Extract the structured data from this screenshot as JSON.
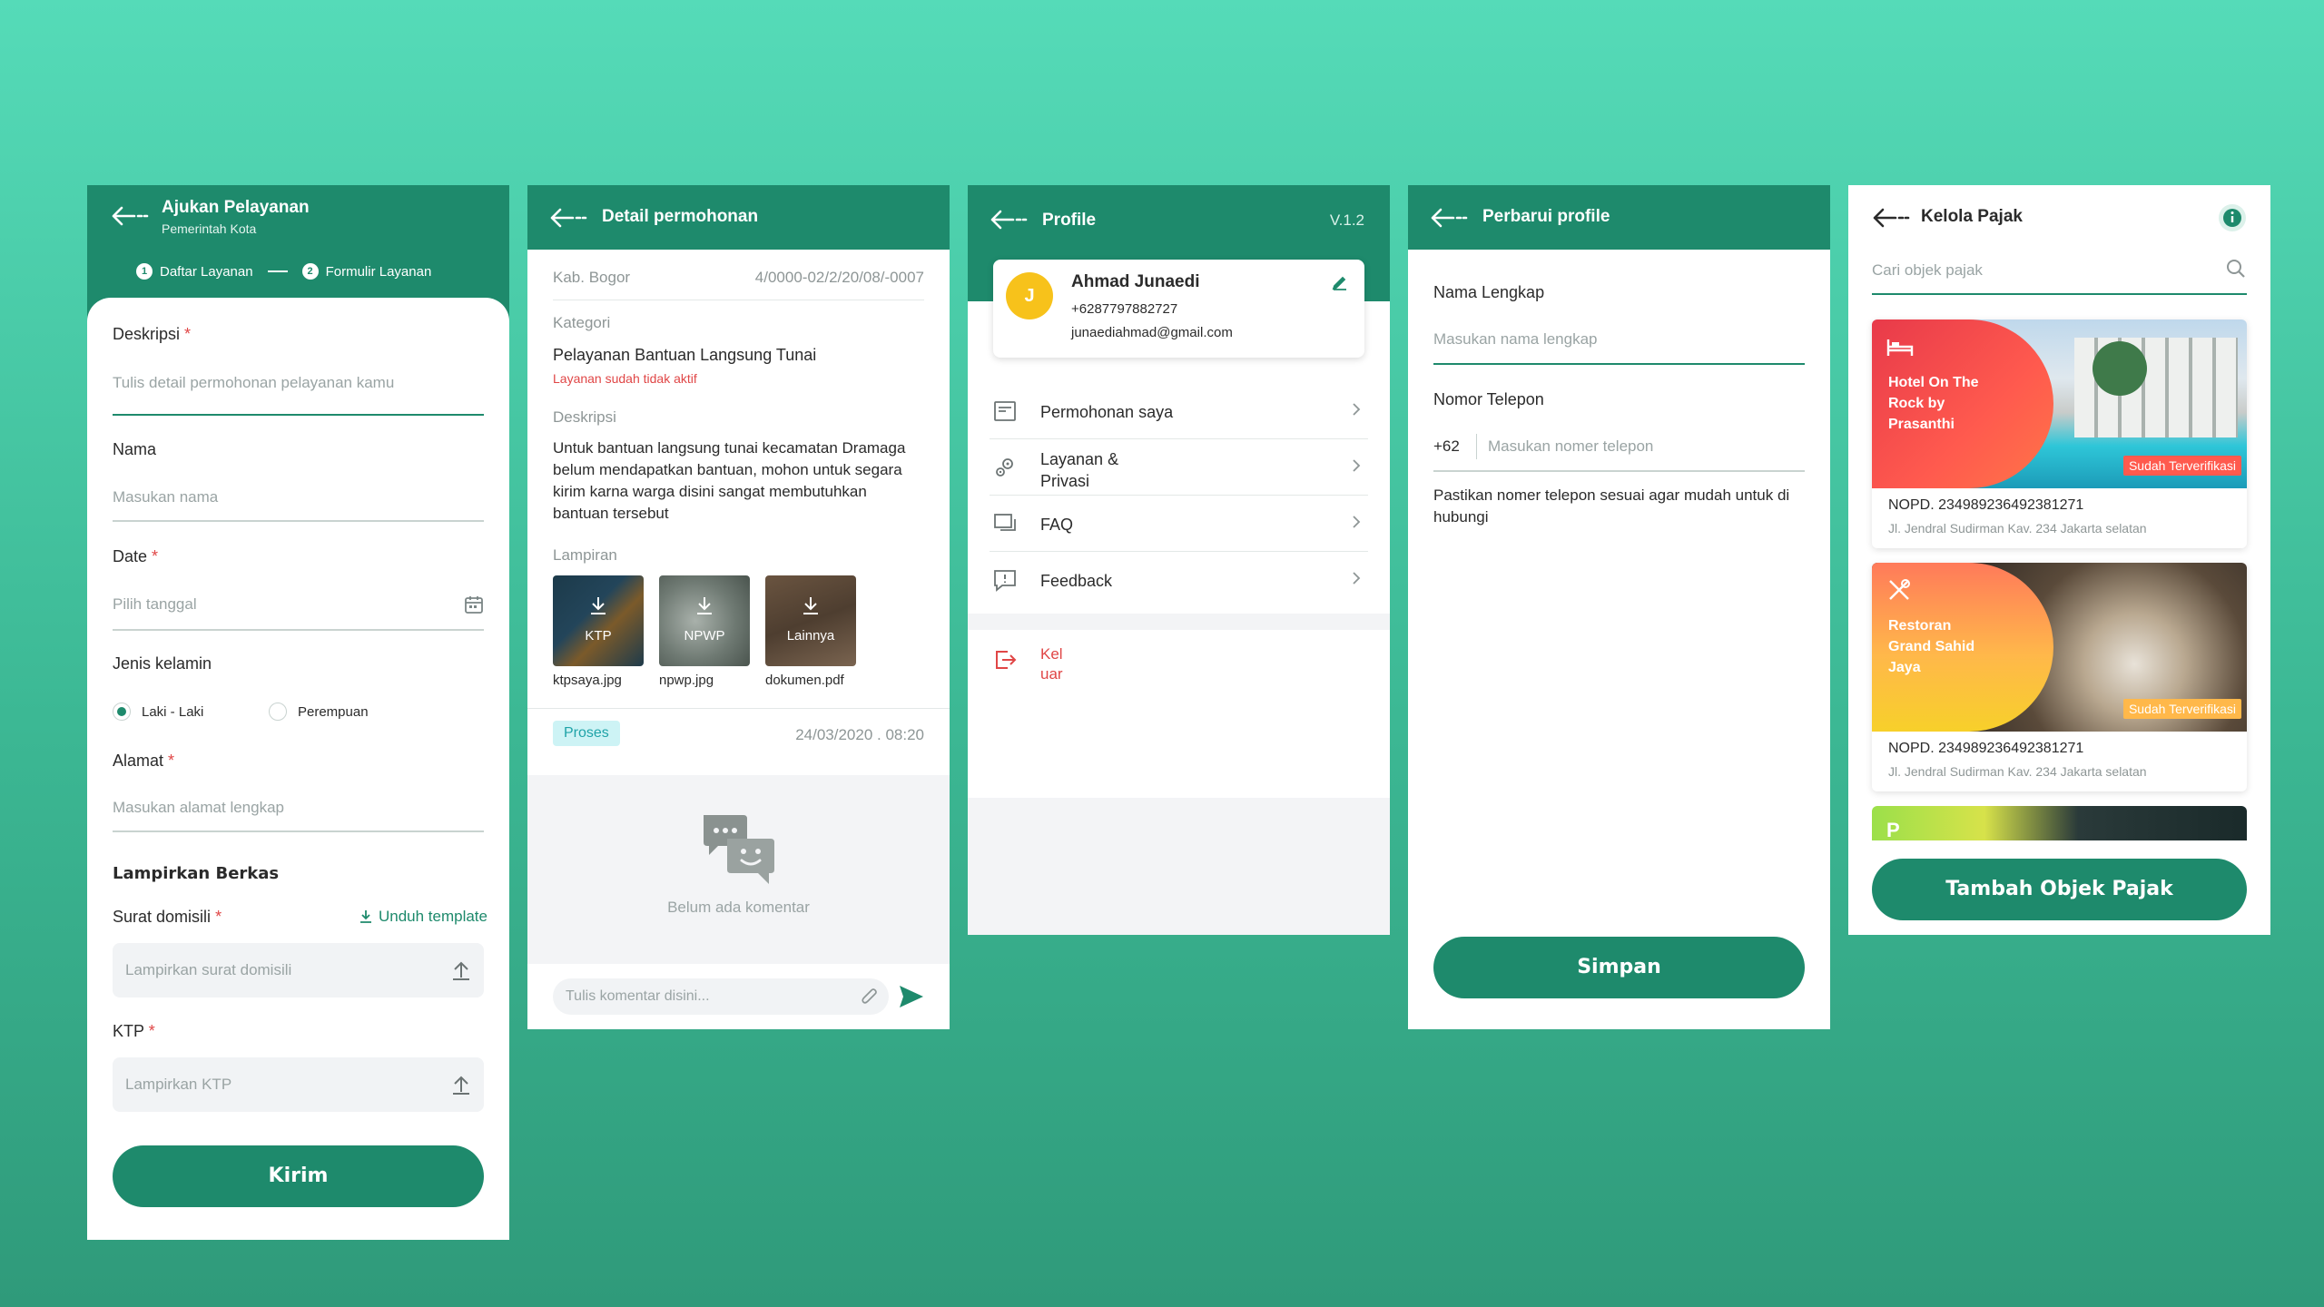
{
  "s1": {
    "title": "Ajukan Pelayanan",
    "subtitle": "Pemerintah Kota",
    "step1_num": "1",
    "step1": "Daftar Layanan",
    "step2_num": "2",
    "step2": "Formulir Layanan",
    "deskripsi_label": "Deskripsi",
    "deskripsi_ph": "Tulis detail permohonan pelayanan kamu",
    "nama_label": "Nama",
    "nama_ph": "Masukan nama",
    "date_label": "Date",
    "date_ph": "Pilih tanggal",
    "gender_label": "Jenis kelamin",
    "gender_opt1": "Laki - Laki",
    "gender_opt2": "Perempuan",
    "alamat_label": "Alamat",
    "alamat_ph": "Masukan alamat lengkap",
    "section": "Lampirkan Berkas",
    "surat_label": "Surat domisili",
    "unduh": "Unduh template",
    "surat_ph": "Lampirkan surat domisili",
    "ktp_label": "KTP",
    "ktp_ph": "Lampirkan KTP",
    "submit": "Kirim",
    "required_mark": "*"
  },
  "s2": {
    "title": "Detail permohonan",
    "location": "Kab. Bogor",
    "ref": "4/0000-02/2/20/08/-0007",
    "kategori_label": "Kategori",
    "kategori": "Pelayanan Bantuan Langsung Tunai",
    "inactive": "Layanan sudah tidak aktif",
    "deskripsi_label": "Deskripsi",
    "deskripsi": "Untuk bantuan langsung tunai kecamatan Dramaga belum mendapatkan bantuan, mohon untuk segara kirim karna warga disini sangat membutuhkan bantuan tersebut",
    "lampiran_label": "Lampiran",
    "files": [
      {
        "tag": "KTP",
        "name": "ktpsaya.jpg"
      },
      {
        "tag": "NPWP",
        "name": "npwp.jpg"
      },
      {
        "tag": "Lainnya",
        "name": "dokumen.pdf"
      }
    ],
    "status": "Proses",
    "datetime": "24/03/2020 . 08:20",
    "empty": "Belum ada komentar",
    "comment_ph": "Tulis komentar disini..."
  },
  "s3": {
    "title": "Profile",
    "version": "V.1.2",
    "avatar": "J",
    "name": "Ahmad Junaedi",
    "phone": "+6287797882727",
    "email": "junaediahmad@gmail.com",
    "menu": [
      "Permohonan saya",
      "Layanan &\nPrivasi",
      "FAQ",
      "Feedback"
    ],
    "logout": "Kel\nuar"
  },
  "s4": {
    "title": "Perbarui profile",
    "nama_label": "Nama Lengkap",
    "nama_ph": "Masukan nama lengkap",
    "tel_label": "Nomor Telepon",
    "prefix": "+62",
    "tel_ph": "Masukan nomer telepon",
    "note": "Pastikan nomer telepon sesuai agar mudah untuk di hubungi",
    "submit": "Simpan"
  },
  "s5": {
    "title": "Kelola Pajak",
    "search_ph": "Cari objek pajak",
    "cards": [
      {
        "name": "Hotel On The Rock by Prasanthi",
        "badge": "Sudah Terverifikasi",
        "nopd": "NOPD. 234989236492381271",
        "addr": "Jl. Jendral Sudirman Kav. 234 Jakarta selatan"
      },
      {
        "name": "Restoran Grand Sahid Jaya",
        "badge": "Sudah Terverifikasi",
        "nopd": "NOPD. 234989236492381271",
        "addr": "Jl. Jendral Sudirman Kav. 234 Jakarta selatan"
      }
    ],
    "third_letter": "P",
    "submit": "Tambah Objek Pajak"
  },
  "colors": {
    "primary": "#1e8a6c",
    "accent_red": "#e04646",
    "yellow": "#f7c21b"
  }
}
